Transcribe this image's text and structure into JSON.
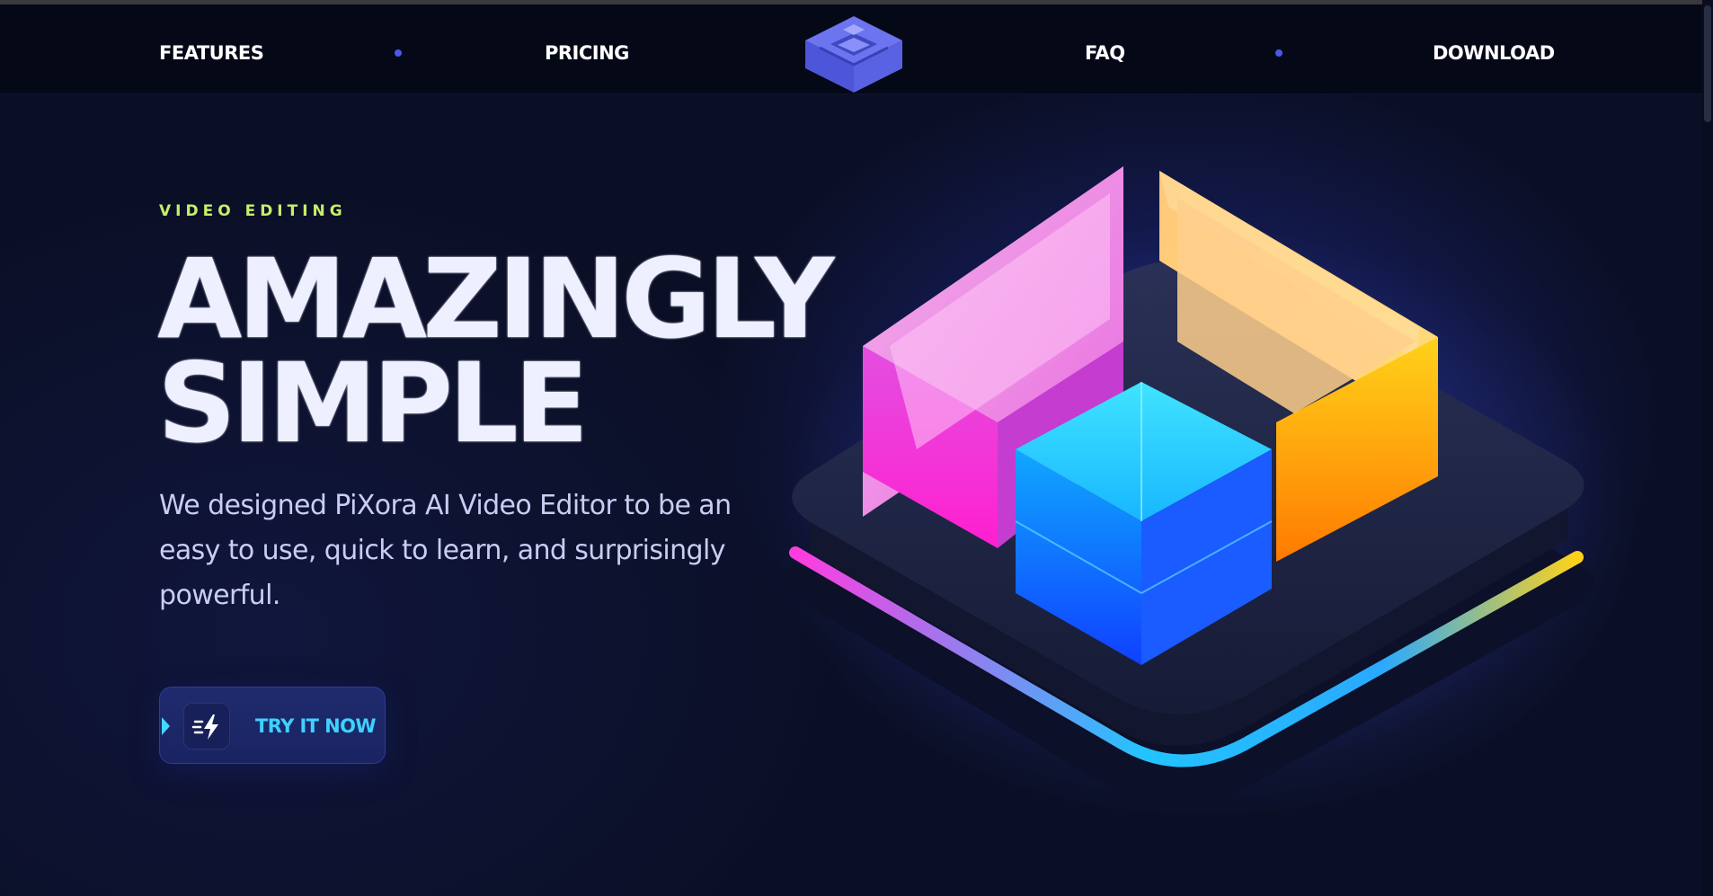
{
  "nav": {
    "links": [
      "FEATURES",
      "PRICING",
      "FAQ",
      "DOWNLOAD"
    ]
  },
  "hero": {
    "eyebrow": "VIDEO EDITING",
    "headline_line1": "AMAZINGLY",
    "headline_line2": "SIMPLE",
    "description": "We designed PiXora AI Video Editor to be an easy to use, quick to learn, and surprisingly powerful.",
    "cta_label": "TRY IT NOW"
  },
  "icons": {
    "logo": "layers-logo-icon",
    "cta": "lightning-icon",
    "hero_art": "glass-blocks-illustration"
  },
  "colors": {
    "background": "#0b0f26",
    "navbar": "#050817",
    "accent_green": "#c4f06a",
    "accent_cyan": "#3fd1ff",
    "brand_purple": "#5b63e6",
    "headline": "#eef0ff"
  }
}
